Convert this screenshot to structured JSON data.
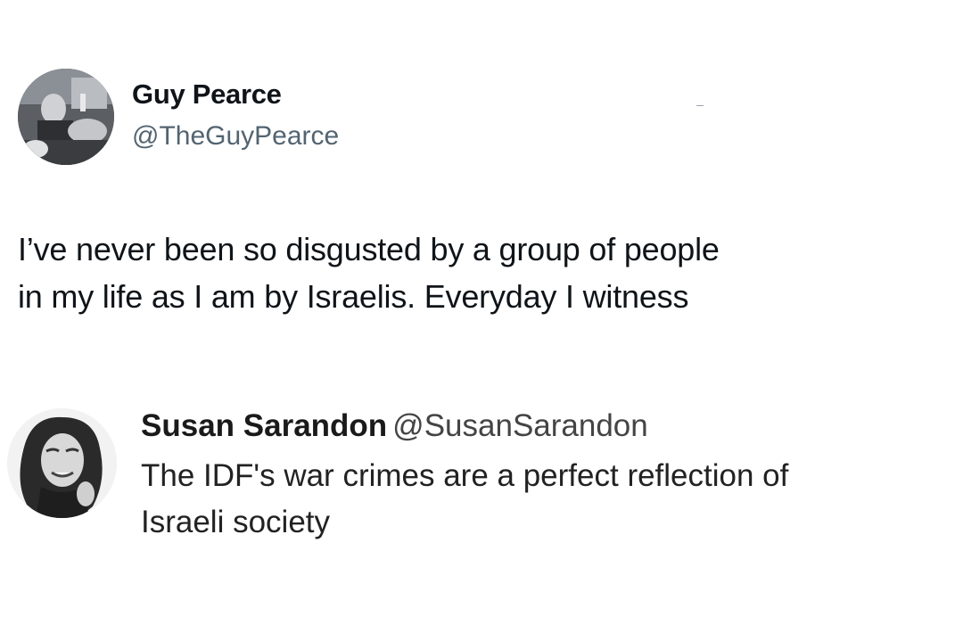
{
  "tweet_main": {
    "display_name": "Guy Pearce",
    "handle": "@TheGuyPearce",
    "text_lines": [
      "I’ve never been so disgusted by a group of people",
      "in my life as I am by Israelis. Everyday I witness"
    ],
    "avatar_icon": "profile-photo-grayscale"
  },
  "tweet_quoted": {
    "display_name": "Susan Sarandon",
    "handle": "@SusanSarandon",
    "text_lines": [
      "The IDF's war crimes are a perfect reflection of",
      "Israeli society"
    ],
    "avatar_icon": "profile-photo-grayscale"
  },
  "colors": {
    "text_primary": "#0f1419",
    "text_secondary": "#536471",
    "background": "#ffffff"
  }
}
